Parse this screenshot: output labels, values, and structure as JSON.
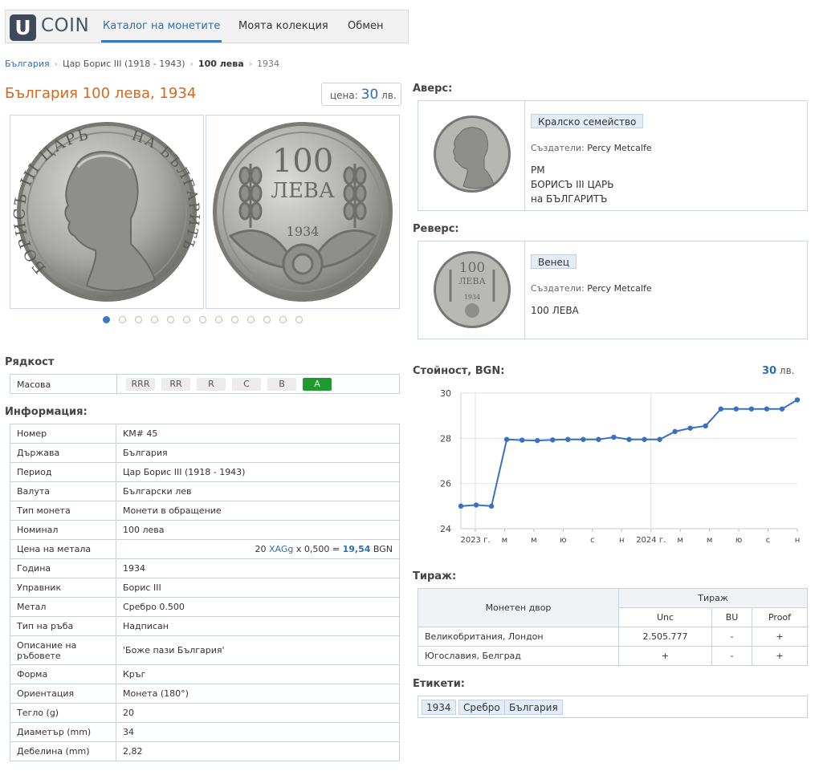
{
  "header": {
    "logo_letter": "U",
    "logo_text": "COIN",
    "tabs": [
      {
        "label": "Каталог на монетите",
        "active": true
      },
      {
        "label": "Моята колекция",
        "active": false
      },
      {
        "label": "Обмен",
        "active": false
      }
    ]
  },
  "breadcrumb": {
    "items": [
      "България",
      "Цар Борис III (1918 - 1943)",
      "100 лева",
      "1934"
    ]
  },
  "title": "България 100 лева, 1934",
  "price": {
    "label": "цена:",
    "value": "30",
    "unit": "лв."
  },
  "obverse_photo_text": {
    "legend_left": "БОРИСЪ III ЦАРЬ",
    "legend_right": "НА БЪЛГАРИТЪ"
  },
  "reverse_photo_text": {
    "denomination": "100",
    "unit": "ЛЕВА",
    "year": "1934"
  },
  "gallery": {
    "count": 13,
    "active": 0
  },
  "rarity": {
    "title": "Рядкост",
    "label": "Масова",
    "levels": [
      "RRR",
      "RR",
      "R",
      "C",
      "B",
      "A"
    ],
    "selected": "A"
  },
  "info": {
    "title": "Информация:",
    "rows": [
      {
        "key": "Номер",
        "value": "KM# 45"
      },
      {
        "key": "Държава",
        "value": "България"
      },
      {
        "key": "Период",
        "value": "Цар Борис III (1918 - 1943)"
      },
      {
        "key": "Валута",
        "value": "Български лев"
      },
      {
        "key": "Тип монета",
        "value": "Монети в обращение"
      },
      {
        "key": "Номинал",
        "value": "100 лева"
      },
      {
        "key": "Цена на метала",
        "value": ""
      },
      {
        "key": "Година",
        "value": "1934"
      },
      {
        "key": "Управник",
        "value": "Борис III"
      },
      {
        "key": "Метал",
        "value": "Сребро 0.500"
      },
      {
        "key": "Тип на ръба",
        "value": "Надписан"
      },
      {
        "key": "Описание на ръбовете",
        "value": "'Боже пази България'"
      },
      {
        "key": "Форма",
        "value": "Кръг"
      },
      {
        "key": "Ориентация",
        "value": "Монета (180°)"
      },
      {
        "key": "Тегло (g)",
        "value": "20"
      },
      {
        "key": "Диаметър (mm)",
        "value": "34"
      },
      {
        "key": "Дебелина (mm)",
        "value": "2,82"
      }
    ],
    "metal_price": {
      "qty": "20",
      "unit": "XAGg",
      "mult": "x 0,500 =",
      "result": "19,54",
      "currency": "BGN"
    }
  },
  "obverse": {
    "title": "Аверс:",
    "tag": "Кралско семейство",
    "creators_label": "Създатели:",
    "creator": "Percy Metcalfe",
    "inscription": "PM\nБОРИСЪ III ЦАРЬ\nна БЪЛГАРИТЪ"
  },
  "reverse": {
    "title": "Реверс:",
    "tag": "Венец",
    "creators_label": "Създатели:",
    "creator": "Percy Metcalfe",
    "inscription": "100 ЛЕВА"
  },
  "value": {
    "title": "Стойност, BGN:",
    "current": "30",
    "unit": "лв."
  },
  "chart_data": {
    "type": "line",
    "x_tick_labels": [
      "2023 г.",
      "м",
      "м",
      "ю",
      "с",
      "н",
      "2024 г.",
      "м",
      "м",
      "ю",
      "с",
      "н"
    ],
    "y_ticks": [
      24,
      26,
      28,
      30
    ],
    "ylim": [
      24,
      30
    ],
    "grid": true,
    "series": [
      {
        "values": [
          25.0,
          25.05,
          25.0,
          27.95,
          27.92,
          27.9,
          27.93,
          27.95,
          27.95,
          27.95,
          28.05,
          27.95,
          27.95,
          27.95,
          28.3,
          28.45,
          28.55,
          29.3,
          29.3,
          29.3,
          29.3,
          29.3,
          29.7
        ],
        "color": "#3a6fc1"
      }
    ]
  },
  "mintage": {
    "title": "Тираж:",
    "col_mint": "Монетен двор",
    "col_group": "Тираж",
    "cols": [
      "Unc",
      "BU",
      "Proof"
    ],
    "rows": [
      {
        "mint": "Великобритания, Лондон",
        "unc": "2.505.777",
        "bu": "-",
        "proof": "+"
      },
      {
        "mint": "Югославия, Белград",
        "unc": "+",
        "bu": "-",
        "proof": "+"
      }
    ]
  },
  "tags": {
    "title": "Етикети:",
    "items": [
      "1934",
      "Сребро",
      "България"
    ]
  }
}
